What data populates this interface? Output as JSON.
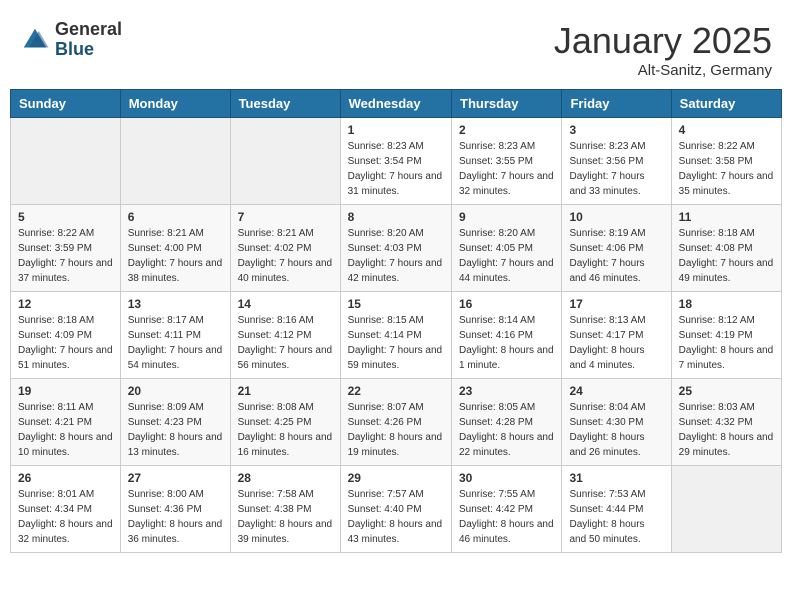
{
  "logo": {
    "general": "General",
    "blue": "Blue"
  },
  "header": {
    "month": "January 2025",
    "location": "Alt-Sanitz, Germany"
  },
  "weekdays": [
    "Sunday",
    "Monday",
    "Tuesday",
    "Wednesday",
    "Thursday",
    "Friday",
    "Saturday"
  ],
  "weeks": [
    [
      {
        "day": "",
        "sunrise": "",
        "sunset": "",
        "daylight": "",
        "empty": true
      },
      {
        "day": "",
        "sunrise": "",
        "sunset": "",
        "daylight": "",
        "empty": true
      },
      {
        "day": "",
        "sunrise": "",
        "sunset": "",
        "daylight": "",
        "empty": true
      },
      {
        "day": "1",
        "sunrise": "Sunrise: 8:23 AM",
        "sunset": "Sunset: 3:54 PM",
        "daylight": "Daylight: 7 hours and 31 minutes."
      },
      {
        "day": "2",
        "sunrise": "Sunrise: 8:23 AM",
        "sunset": "Sunset: 3:55 PM",
        "daylight": "Daylight: 7 hours and 32 minutes."
      },
      {
        "day": "3",
        "sunrise": "Sunrise: 8:23 AM",
        "sunset": "Sunset: 3:56 PM",
        "daylight": "Daylight: 7 hours and 33 minutes."
      },
      {
        "day": "4",
        "sunrise": "Sunrise: 8:22 AM",
        "sunset": "Sunset: 3:58 PM",
        "daylight": "Daylight: 7 hours and 35 minutes."
      }
    ],
    [
      {
        "day": "5",
        "sunrise": "Sunrise: 8:22 AM",
        "sunset": "Sunset: 3:59 PM",
        "daylight": "Daylight: 7 hours and 37 minutes."
      },
      {
        "day": "6",
        "sunrise": "Sunrise: 8:21 AM",
        "sunset": "Sunset: 4:00 PM",
        "daylight": "Daylight: 7 hours and 38 minutes."
      },
      {
        "day": "7",
        "sunrise": "Sunrise: 8:21 AM",
        "sunset": "Sunset: 4:02 PM",
        "daylight": "Daylight: 7 hours and 40 minutes."
      },
      {
        "day": "8",
        "sunrise": "Sunrise: 8:20 AM",
        "sunset": "Sunset: 4:03 PM",
        "daylight": "Daylight: 7 hours and 42 minutes."
      },
      {
        "day": "9",
        "sunrise": "Sunrise: 8:20 AM",
        "sunset": "Sunset: 4:05 PM",
        "daylight": "Daylight: 7 hours and 44 minutes."
      },
      {
        "day": "10",
        "sunrise": "Sunrise: 8:19 AM",
        "sunset": "Sunset: 4:06 PM",
        "daylight": "Daylight: 7 hours and 46 minutes."
      },
      {
        "day": "11",
        "sunrise": "Sunrise: 8:18 AM",
        "sunset": "Sunset: 4:08 PM",
        "daylight": "Daylight: 7 hours and 49 minutes."
      }
    ],
    [
      {
        "day": "12",
        "sunrise": "Sunrise: 8:18 AM",
        "sunset": "Sunset: 4:09 PM",
        "daylight": "Daylight: 7 hours and 51 minutes."
      },
      {
        "day": "13",
        "sunrise": "Sunrise: 8:17 AM",
        "sunset": "Sunset: 4:11 PM",
        "daylight": "Daylight: 7 hours and 54 minutes."
      },
      {
        "day": "14",
        "sunrise": "Sunrise: 8:16 AM",
        "sunset": "Sunset: 4:12 PM",
        "daylight": "Daylight: 7 hours and 56 minutes."
      },
      {
        "day": "15",
        "sunrise": "Sunrise: 8:15 AM",
        "sunset": "Sunset: 4:14 PM",
        "daylight": "Daylight: 7 hours and 59 minutes."
      },
      {
        "day": "16",
        "sunrise": "Sunrise: 8:14 AM",
        "sunset": "Sunset: 4:16 PM",
        "daylight": "Daylight: 8 hours and 1 minute."
      },
      {
        "day": "17",
        "sunrise": "Sunrise: 8:13 AM",
        "sunset": "Sunset: 4:17 PM",
        "daylight": "Daylight: 8 hours and 4 minutes."
      },
      {
        "day": "18",
        "sunrise": "Sunrise: 8:12 AM",
        "sunset": "Sunset: 4:19 PM",
        "daylight": "Daylight: 8 hours and 7 minutes."
      }
    ],
    [
      {
        "day": "19",
        "sunrise": "Sunrise: 8:11 AM",
        "sunset": "Sunset: 4:21 PM",
        "daylight": "Daylight: 8 hours and 10 minutes."
      },
      {
        "day": "20",
        "sunrise": "Sunrise: 8:09 AM",
        "sunset": "Sunset: 4:23 PM",
        "daylight": "Daylight: 8 hours and 13 minutes."
      },
      {
        "day": "21",
        "sunrise": "Sunrise: 8:08 AM",
        "sunset": "Sunset: 4:25 PM",
        "daylight": "Daylight: 8 hours and 16 minutes."
      },
      {
        "day": "22",
        "sunrise": "Sunrise: 8:07 AM",
        "sunset": "Sunset: 4:26 PM",
        "daylight": "Daylight: 8 hours and 19 minutes."
      },
      {
        "day": "23",
        "sunrise": "Sunrise: 8:05 AM",
        "sunset": "Sunset: 4:28 PM",
        "daylight": "Daylight: 8 hours and 22 minutes."
      },
      {
        "day": "24",
        "sunrise": "Sunrise: 8:04 AM",
        "sunset": "Sunset: 4:30 PM",
        "daylight": "Daylight: 8 hours and 26 minutes."
      },
      {
        "day": "25",
        "sunrise": "Sunrise: 8:03 AM",
        "sunset": "Sunset: 4:32 PM",
        "daylight": "Daylight: 8 hours and 29 minutes."
      }
    ],
    [
      {
        "day": "26",
        "sunrise": "Sunrise: 8:01 AM",
        "sunset": "Sunset: 4:34 PM",
        "daylight": "Daylight: 8 hours and 32 minutes."
      },
      {
        "day": "27",
        "sunrise": "Sunrise: 8:00 AM",
        "sunset": "Sunset: 4:36 PM",
        "daylight": "Daylight: 8 hours and 36 minutes."
      },
      {
        "day": "28",
        "sunrise": "Sunrise: 7:58 AM",
        "sunset": "Sunset: 4:38 PM",
        "daylight": "Daylight: 8 hours and 39 minutes."
      },
      {
        "day": "29",
        "sunrise": "Sunrise: 7:57 AM",
        "sunset": "Sunset: 4:40 PM",
        "daylight": "Daylight: 8 hours and 43 minutes."
      },
      {
        "day": "30",
        "sunrise": "Sunrise: 7:55 AM",
        "sunset": "Sunset: 4:42 PM",
        "daylight": "Daylight: 8 hours and 46 minutes."
      },
      {
        "day": "31",
        "sunrise": "Sunrise: 7:53 AM",
        "sunset": "Sunset: 4:44 PM",
        "daylight": "Daylight: 8 hours and 50 minutes."
      },
      {
        "day": "",
        "sunrise": "",
        "sunset": "",
        "daylight": "",
        "empty": true
      }
    ]
  ]
}
